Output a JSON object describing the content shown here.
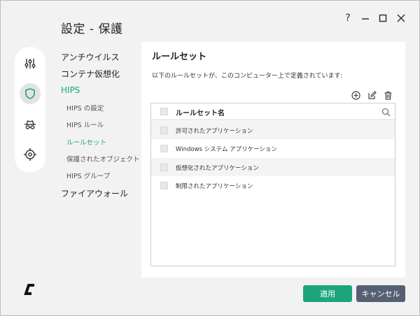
{
  "window": {
    "title": "設定 - 保護",
    "controls": {
      "help": "?",
      "minimize": "minimize-icon",
      "maximize": "maximize-icon",
      "close": "close-icon"
    }
  },
  "iconbar": {
    "items": [
      {
        "name": "sliders-icon",
        "active": false
      },
      {
        "name": "shield-icon",
        "active": true
      },
      {
        "name": "spy-hat-icon",
        "active": false
      },
      {
        "name": "target-icon",
        "active": false
      }
    ]
  },
  "nav": {
    "items": [
      {
        "label": "アンチウイルス"
      },
      {
        "label": "コンテナ仮想化"
      },
      {
        "label": "HIPS",
        "active": true
      },
      {
        "label": "ファイアウォール"
      }
    ],
    "sub_items": [
      {
        "label": "HIPS の設定"
      },
      {
        "label": "HIPS ルール"
      },
      {
        "label": "ルールセット",
        "active": true
      },
      {
        "label": "保護されたオブジェクト"
      },
      {
        "label": "HIPS グループ"
      }
    ]
  },
  "panel": {
    "title": "ルールセット",
    "description": "以下のルールセットが、このコンピューター上で定義されています:",
    "tools": [
      "add-icon",
      "edit-icon",
      "delete-icon"
    ],
    "table": {
      "header": "ルールセット名",
      "rows": [
        "許可されたアプリケーション",
        "Windows システム アプリケーション",
        "仮想化されたアプリケーション",
        "制限されたアプリケーション"
      ]
    }
  },
  "footer": {
    "apply_label": "適用",
    "cancel_label": "キャンセル"
  },
  "colors": {
    "accent": "#1ca57a",
    "cancel": "#566073",
    "background": "#f2f2f2"
  }
}
